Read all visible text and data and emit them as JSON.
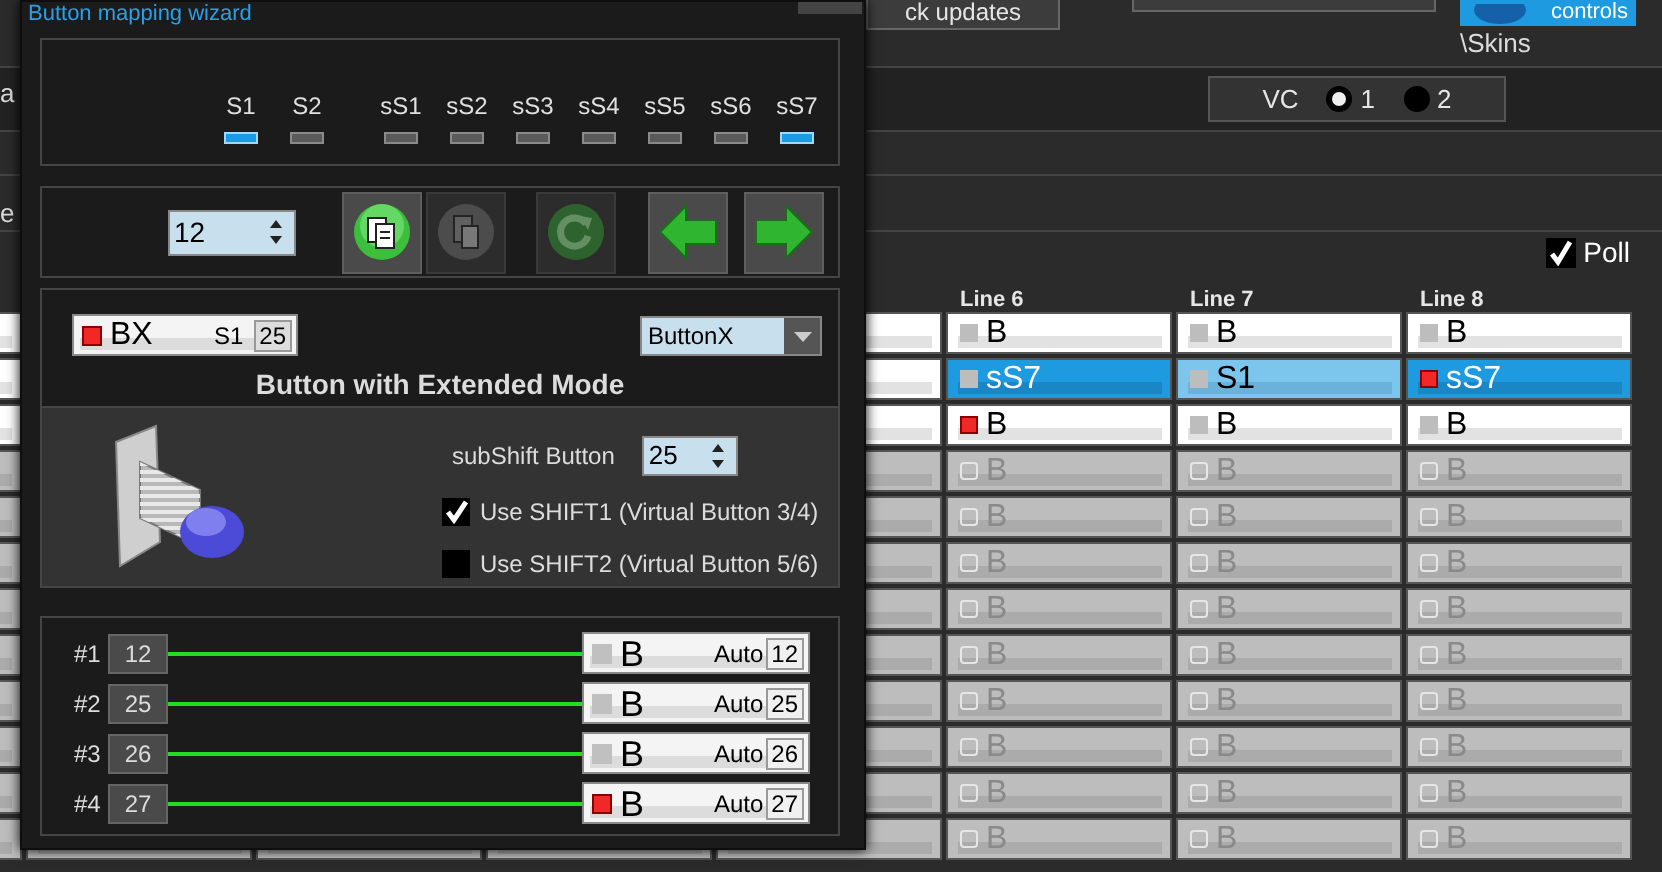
{
  "window": {
    "title": "Button mapping wizard"
  },
  "background": {
    "top_button": {
      "label": "ck updates"
    },
    "controls_button": {
      "label": "controls"
    },
    "skins_path": "\\Skins",
    "left_texts": [
      "a",
      "e"
    ],
    "vc": {
      "label": "VC",
      "options": [
        {
          "label": "1",
          "selected": true
        },
        {
          "label": "2",
          "selected": false
        }
      ]
    },
    "poll": {
      "label": "Poll",
      "checked": true
    },
    "table": {
      "columns": [
        "Line 6",
        "Line 7",
        "Line 8"
      ],
      "rows": [
        {
          "cells": [
            {
              "label": "B",
              "selected": false,
              "focused": false,
              "disabled": false,
              "led_on": false
            },
            {
              "label": "B",
              "selected": false,
              "focused": false,
              "disabled": false,
              "led_on": false
            },
            {
              "label": "B",
              "selected": false,
              "focused": false,
              "disabled": false,
              "led_on": false
            }
          ]
        },
        {
          "cells": [
            {
              "label": "sS7",
              "selected": true,
              "focused": false,
              "disabled": false,
              "led_on": false
            },
            {
              "label": "S1",
              "selected": true,
              "focused": true,
              "disabled": false,
              "led_on": false
            },
            {
              "label": "sS7",
              "selected": true,
              "focused": false,
              "disabled": false,
              "led_on": true
            }
          ]
        },
        {
          "cells": [
            {
              "label": "B",
              "selected": false,
              "focused": false,
              "disabled": false,
              "led_on": true
            },
            {
              "label": "B",
              "selected": false,
              "focused": false,
              "disabled": false,
              "led_on": false
            },
            {
              "label": "B",
              "selected": false,
              "focused": false,
              "disabled": false,
              "led_on": false
            }
          ]
        },
        {
          "cells": [
            {
              "label": "B",
              "selected": false,
              "focused": false,
              "disabled": true,
              "led_on": false
            },
            {
              "label": "B",
              "selected": false,
              "focused": false,
              "disabled": true,
              "led_on": false
            },
            {
              "label": "B",
              "selected": false,
              "focused": false,
              "disabled": true,
              "led_on": false
            }
          ]
        },
        {
          "cells": [
            {
              "label": "B",
              "selected": false,
              "focused": false,
              "disabled": true,
              "led_on": false
            },
            {
              "label": "B",
              "selected": false,
              "focused": false,
              "disabled": true,
              "led_on": false
            },
            {
              "label": "B",
              "selected": false,
              "focused": false,
              "disabled": true,
              "led_on": false
            }
          ]
        },
        {
          "cells": [
            {
              "label": "B",
              "selected": false,
              "focused": false,
              "disabled": true,
              "led_on": false
            },
            {
              "label": "B",
              "selected": false,
              "focused": false,
              "disabled": true,
              "led_on": false
            },
            {
              "label": "B",
              "selected": false,
              "focused": false,
              "disabled": true,
              "led_on": false
            }
          ]
        },
        {
          "cells": [
            {
              "label": "B",
              "selected": false,
              "focused": false,
              "disabled": true,
              "led_on": false
            },
            {
              "label": "B",
              "selected": false,
              "focused": false,
              "disabled": true,
              "led_on": false
            },
            {
              "label": "B",
              "selected": false,
              "focused": false,
              "disabled": true,
              "led_on": false
            }
          ]
        },
        {
          "cells": [
            {
              "label": "B",
              "selected": false,
              "focused": false,
              "disabled": true,
              "led_on": false
            },
            {
              "label": "B",
              "selected": false,
              "focused": false,
              "disabled": true,
              "led_on": false
            },
            {
              "label": "B",
              "selected": false,
              "focused": false,
              "disabled": true,
              "led_on": false
            }
          ]
        },
        {
          "cells": [
            {
              "label": "B",
              "selected": false,
              "focused": false,
              "disabled": true,
              "led_on": false
            },
            {
              "label": "B",
              "selected": false,
              "focused": false,
              "disabled": true,
              "led_on": false
            },
            {
              "label": "B",
              "selected": false,
              "focused": false,
              "disabled": true,
              "led_on": false
            }
          ]
        },
        {
          "cells": [
            {
              "label": "B",
              "selected": false,
              "focused": false,
              "disabled": true,
              "led_on": false
            },
            {
              "label": "B",
              "selected": false,
              "focused": false,
              "disabled": true,
              "led_on": false
            },
            {
              "label": "B",
              "selected": false,
              "focused": false,
              "disabled": true,
              "led_on": false
            }
          ]
        },
        {
          "cells": [
            {
              "label": "B",
              "selected": false,
              "focused": false,
              "disabled": true,
              "led_on": false
            },
            {
              "label": "B",
              "selected": false,
              "focused": false,
              "disabled": true,
              "led_on": false
            },
            {
              "label": "B",
              "selected": false,
              "focused": false,
              "disabled": true,
              "led_on": false
            }
          ]
        },
        {
          "cells": [
            {
              "label": "B",
              "selected": false,
              "focused": false,
              "disabled": true,
              "led_on": false
            },
            {
              "label": "B",
              "selected": false,
              "focused": false,
              "disabled": true,
              "led_on": false
            },
            {
              "label": "B",
              "selected": false,
              "focused": false,
              "disabled": true,
              "led_on": false
            }
          ]
        }
      ]
    }
  },
  "shift_groups": [
    {
      "indicators": [
        {
          "label": "S1",
          "on": true
        },
        {
          "label": "S2",
          "on": false
        }
      ]
    },
    {
      "indicators": [
        {
          "label": "sS1",
          "on": false
        },
        {
          "label": "sS2",
          "on": false
        },
        {
          "label": "sS3",
          "on": false
        },
        {
          "label": "sS4",
          "on": false
        },
        {
          "label": "sS5",
          "on": false
        },
        {
          "label": "sS6",
          "on": false
        },
        {
          "label": "sS7",
          "on": true
        }
      ]
    }
  ],
  "toolbar": {
    "button_number": "12",
    "buttons": [
      {
        "kind": "copy",
        "disabled": false
      },
      {
        "kind": "paste",
        "disabled": true
      },
      {
        "kind": "reset",
        "disabled": true
      },
      {
        "kind": "previous",
        "disabled": false
      },
      {
        "kind": "next",
        "disabled": false
      }
    ]
  },
  "button_config": {
    "chip": {
      "label": "BX",
      "led_on": true,
      "shift": "S1",
      "number": "25"
    },
    "type_dropdown": {
      "value": "ButtonX"
    },
    "mode_title": "Button with Extended Mode",
    "subshift": {
      "label": "subShift Button",
      "value": "25"
    },
    "options": [
      {
        "label": "Use SHIFT1 (Virtual Button 3/4)",
        "checked": true
      },
      {
        "label": "Use SHIFT2 (Virtual Button 5/6)",
        "checked": false
      }
    ]
  },
  "mappings": [
    {
      "index": "#1",
      "button": "12",
      "target": {
        "label": "B",
        "led_on": false,
        "mode": "Auto",
        "number": "12"
      }
    },
    {
      "index": "#2",
      "button": "25",
      "target": {
        "label": "B",
        "led_on": false,
        "mode": "Auto",
        "number": "25"
      }
    },
    {
      "index": "#3",
      "button": "26",
      "target": {
        "label": "B",
        "led_on": false,
        "mode": "Auto",
        "number": "26"
      }
    },
    {
      "index": "#4",
      "button": "27",
      "target": {
        "label": "B",
        "led_on": true,
        "mode": "Auto",
        "number": "27"
      }
    }
  ]
}
